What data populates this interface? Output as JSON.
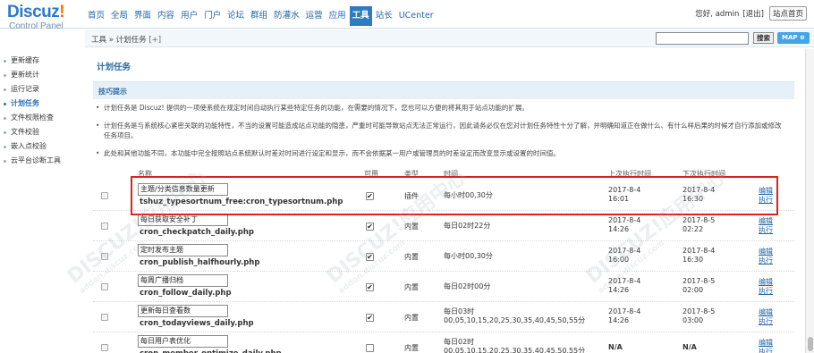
{
  "logo": {
    "main": "Discuz",
    "bang": "!",
    "sub": "Control Panel"
  },
  "nav": [
    "首页",
    "全局",
    "界面",
    "内容",
    "用户",
    "门户",
    "论坛",
    "群组",
    "防灌水",
    "运营",
    "应用",
    "工具",
    "站长",
    "UCenter"
  ],
  "nav_active_index": 11,
  "header": {
    "greeting": "您好, admin",
    "logout": "[退出]",
    "home": "站点首页"
  },
  "breadcrumb": {
    "text": "工具 » 计划任务",
    "plus": "[+]"
  },
  "search": {
    "button": "搜索",
    "map": "MAP ⊕"
  },
  "sidebar": [
    {
      "label": "更新缓存"
    },
    {
      "label": "更新统计"
    },
    {
      "label": "运行记录"
    },
    {
      "label": "计划任务"
    },
    {
      "label": "文件权限检查"
    },
    {
      "label": "文件校验"
    },
    {
      "label": "嵌入点校验"
    },
    {
      "label": "云平台诊断工具"
    }
  ],
  "sidebar_active_index": 3,
  "page_title": "计划任务",
  "tips": {
    "title": "技巧提示",
    "items": [
      "计划任务是 Discuz! 提供的一项使系统在规定时间自动执行某些特定任务的功能，在需要的情况下，您也可以方便的将其用于站点功能的扩展。",
      "计划任务是与系统核心紧密关联的功能特性，不当的设置可能造成站点功能的隐患，严重时可能导致站点无法正常运行，因此请务必仅在您对计划任务特性十分了解，并明确知道正在做什么、有什么样后果的时候才自行添加或修改任务项目。",
      "此处和其他功能不同，本功能中完全按照站点系统默认时差对时间进行设定和显示，而不会依据某一用户或管理员的时差设定而改变显示或设置的时间值。"
    ]
  },
  "table": {
    "headers": [
      "名称",
      "可用",
      "类型",
      "时间",
      "上次执行时间",
      "下次执行时间"
    ],
    "edit_label": "编辑",
    "run_label": "执行",
    "rows": [
      {
        "name": "主题/分类信息数量更新",
        "file": "tshuz_typesortnum_free:cron_typesortnum.php",
        "enabled": "✔",
        "type": "插件",
        "time": [
          "每小时00,30分"
        ],
        "last": [
          "2017-8-4",
          "16:01"
        ],
        "next": [
          "2017-8-4",
          "16:30"
        ]
      },
      {
        "name": "每日获取安全补丁",
        "file": "cron_checkpatch_daily.php",
        "enabled": "✔",
        "type": "内置",
        "time": [
          "每日02时22分"
        ],
        "last": [
          "2017-8-4",
          "14:26"
        ],
        "next": [
          "2017-8-5",
          "02:22"
        ]
      },
      {
        "name": "定时发布主题",
        "file": "cron_publish_halfhourly.php",
        "enabled": "✔",
        "type": "内置",
        "time": [
          "每小时00,30分"
        ],
        "last": [
          "2017-8-4",
          "16:00"
        ],
        "next": [
          "2017-8-4",
          "16:30"
        ]
      },
      {
        "name": "每周广播归档",
        "file": "cron_follow_daily.php",
        "enabled": "✔",
        "type": "内置",
        "time": [
          "每日02时00分"
        ],
        "last": [
          "2017-8-4",
          "14:26"
        ],
        "next": [
          "2017-8-5",
          "02:00"
        ]
      },
      {
        "name": "更新每日查看数",
        "file": "cron_todayviews_daily.php",
        "enabled": "✔",
        "type": "内置",
        "time": [
          "每日03时",
          "00,05,10,15,20,25,30,35,40,45,50,55分"
        ],
        "last": [
          "2017-8-4",
          "14:26"
        ],
        "next": [
          "2017-8-5",
          "03:00"
        ]
      },
      {
        "name": "每日用户表优化",
        "file": "cron_member_optimize_daily.php",
        "enabled": "",
        "type": "内置",
        "time": [
          "每日02时",
          "00,05,10,15,20,25,30,35,40,45,50,55分"
        ],
        "last": [
          "N/A"
        ],
        "next": [
          "N/A"
        ]
      }
    ]
  },
  "watermark": {
    "text": "DISCUZ!应用中心",
    "sub": "addon.discuz.com"
  },
  "colors": {
    "accent": "#2f7bbf",
    "highlight_border": "#e02020",
    "link": "#2366a8"
  }
}
